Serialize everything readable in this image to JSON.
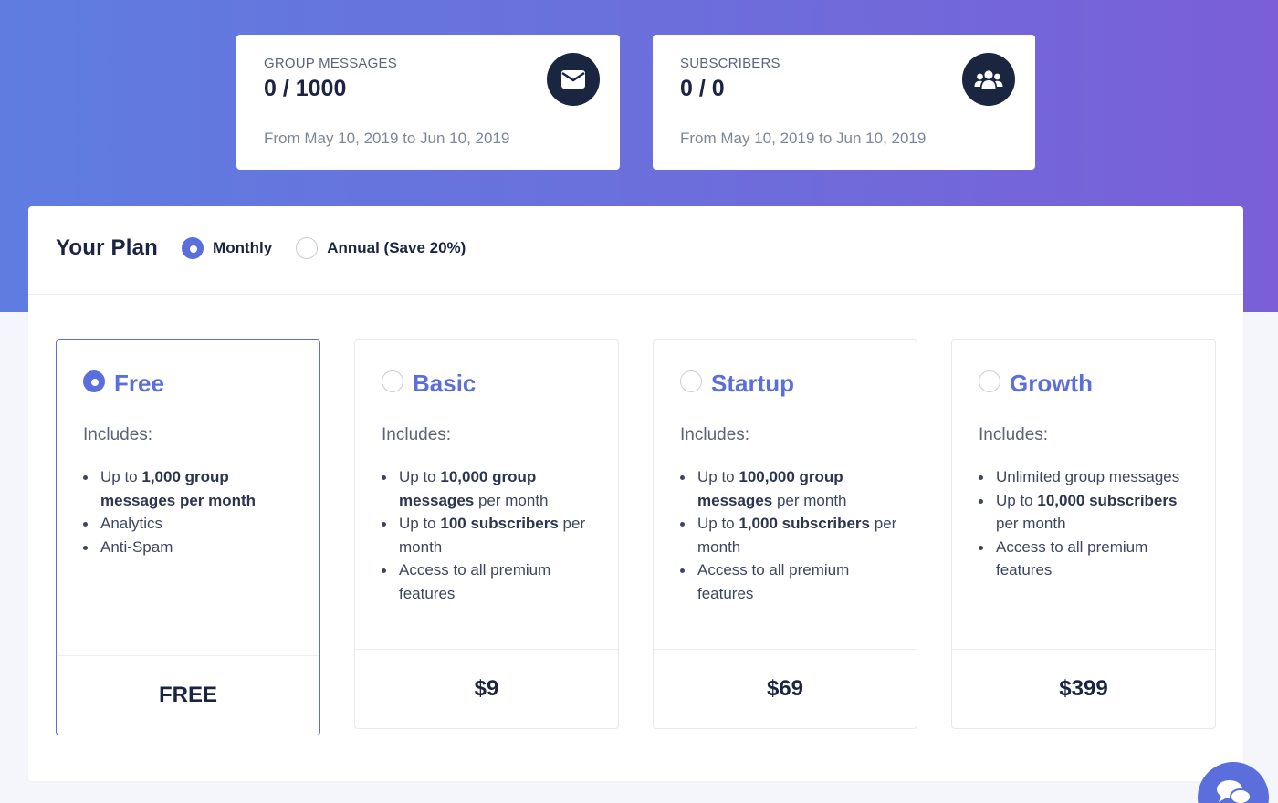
{
  "stats": {
    "messages": {
      "label": "GROUP MESSAGES",
      "value": "0 / 1000",
      "range": "From May 10, 2019 to Jun 10, 2019",
      "icon": "envelope-icon"
    },
    "subscribers": {
      "label": "SUBSCRIBERS",
      "value": "0 / 0",
      "range": "From May 10, 2019 to Jun 10, 2019",
      "icon": "users-icon"
    }
  },
  "plan": {
    "title": "Your Plan",
    "billing": {
      "options": [
        {
          "label": "Monthly",
          "selected": true
        },
        {
          "label": "Annual (Save 20%)",
          "selected": false
        }
      ]
    },
    "tiers": [
      {
        "name": "Free",
        "selected": true,
        "includes_label": "Includes:",
        "features": [
          {
            "parts": [
              {
                "text": "Up to ",
                "bold": false
              },
              {
                "text": "1,000 group messages per month",
                "bold": true
              }
            ]
          },
          {
            "parts": [
              {
                "text": "Analytics",
                "bold": false
              }
            ]
          },
          {
            "parts": [
              {
                "text": "Anti-Spam",
                "bold": false
              }
            ]
          }
        ],
        "price": "FREE"
      },
      {
        "name": "Basic",
        "selected": false,
        "includes_label": "Includes:",
        "features": [
          {
            "parts": [
              {
                "text": "Up to ",
                "bold": false
              },
              {
                "text": "10,000 group messages",
                "bold": true
              },
              {
                "text": " per month",
                "bold": false
              }
            ]
          },
          {
            "parts": [
              {
                "text": "Up to ",
                "bold": false
              },
              {
                "text": "100 subscribers",
                "bold": true
              },
              {
                "text": " per month",
                "bold": false
              }
            ]
          },
          {
            "parts": [
              {
                "text": "Access to all premium features",
                "bold": false
              }
            ]
          }
        ],
        "price": "$9"
      },
      {
        "name": "Startup",
        "selected": false,
        "includes_label": "Includes:",
        "features": [
          {
            "parts": [
              {
                "text": "Up to ",
                "bold": false
              },
              {
                "text": "100,000 group messages",
                "bold": true
              },
              {
                "text": " per month",
                "bold": false
              }
            ]
          },
          {
            "parts": [
              {
                "text": "Up to ",
                "bold": false
              },
              {
                "text": "1,000 subscribers",
                "bold": true
              },
              {
                "text": " per month",
                "bold": false
              }
            ]
          },
          {
            "parts": [
              {
                "text": "Access to all premium features",
                "bold": false
              }
            ]
          }
        ],
        "price": "$69"
      },
      {
        "name": "Growth",
        "selected": false,
        "includes_label": "Includes:",
        "features": [
          {
            "parts": [
              {
                "text": "Unlimited group messages",
                "bold": false
              }
            ]
          },
          {
            "parts": [
              {
                "text": "Up to ",
                "bold": false
              },
              {
                "text": "10,000 subscribers",
                "bold": true
              },
              {
                "text": " per month",
                "bold": false
              }
            ]
          },
          {
            "parts": [
              {
                "text": "Access to all premium features",
                "bold": false
              }
            ]
          }
        ],
        "price": "$399"
      }
    ]
  },
  "chat": {
    "icon": "chat-bubbles-icon"
  },
  "colors": {
    "accent": "#5b6fdc",
    "dark": "#1a2540",
    "hero_start": "#5f7de0",
    "hero_end": "#7a5fd8"
  }
}
